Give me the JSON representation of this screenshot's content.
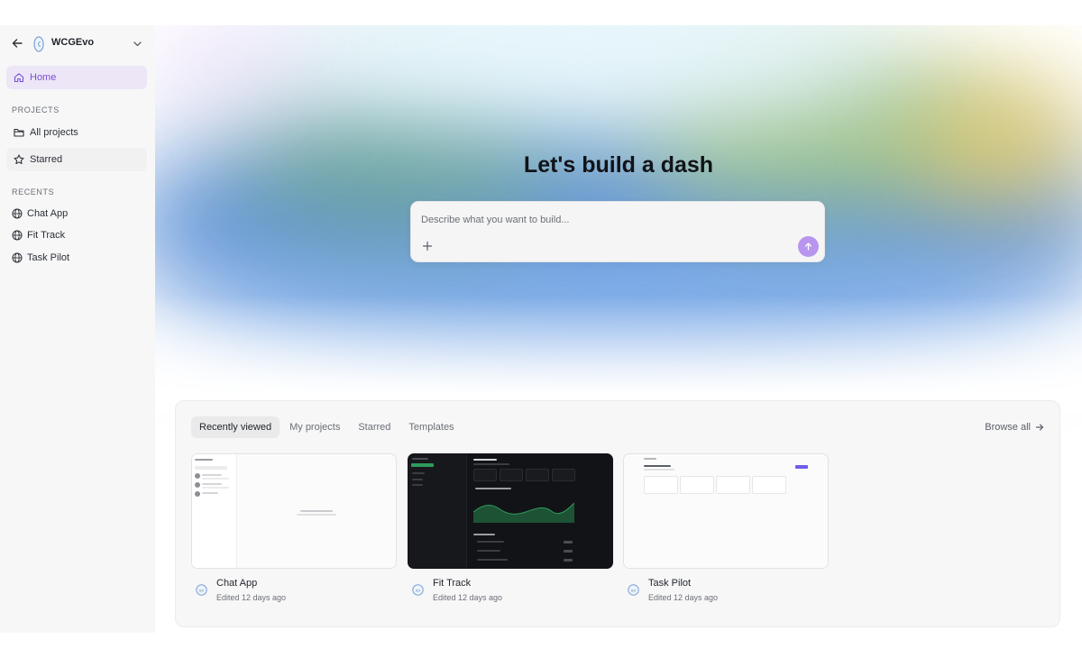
{
  "workspace": {
    "name": "WCGEvo"
  },
  "sidebar": {
    "home_label": "Home",
    "projects_heading": "PROJECTS",
    "all_projects_label": "All projects",
    "starred_label": "Starred",
    "recents_heading": "RECENTS",
    "recents": [
      {
        "label": "Chat App"
      },
      {
        "label": "Fit Track"
      },
      {
        "label": "Task Pilot"
      }
    ]
  },
  "hero": {
    "title": "Let's build a dash",
    "prompt_placeholder": "Describe what you want to build..."
  },
  "projects_panel": {
    "tabs": [
      {
        "label": "Recently viewed",
        "active": true
      },
      {
        "label": "My projects",
        "active": false
      },
      {
        "label": "Starred",
        "active": false
      },
      {
        "label": "Templates",
        "active": false
      }
    ],
    "browse_all_label": "Browse all",
    "cards": [
      {
        "title": "Chat App",
        "subtitle": "Edited 12 days ago"
      },
      {
        "title": "Fit Track",
        "subtitle": "Edited 12 days ago"
      },
      {
        "title": "Task Pilot",
        "subtitle": "Edited 12 days ago"
      }
    ]
  },
  "colors": {
    "accent": "#7c4fd6",
    "home_active_bg": "#ece6f7",
    "send_button": "#b895ef",
    "fit_chart_green": "#2f9a5c"
  },
  "icons": {
    "back": "arrow-left-icon",
    "workspace_logo": "workspace-logo-icon",
    "chevron": "chevron-down-icon",
    "home": "home-icon",
    "all_projects": "folder-icon",
    "starred": "star-icon",
    "recent": "globe-icon",
    "attach": "plus-icon",
    "send": "arrow-up-icon",
    "browse_all": "arrow-right-icon"
  }
}
